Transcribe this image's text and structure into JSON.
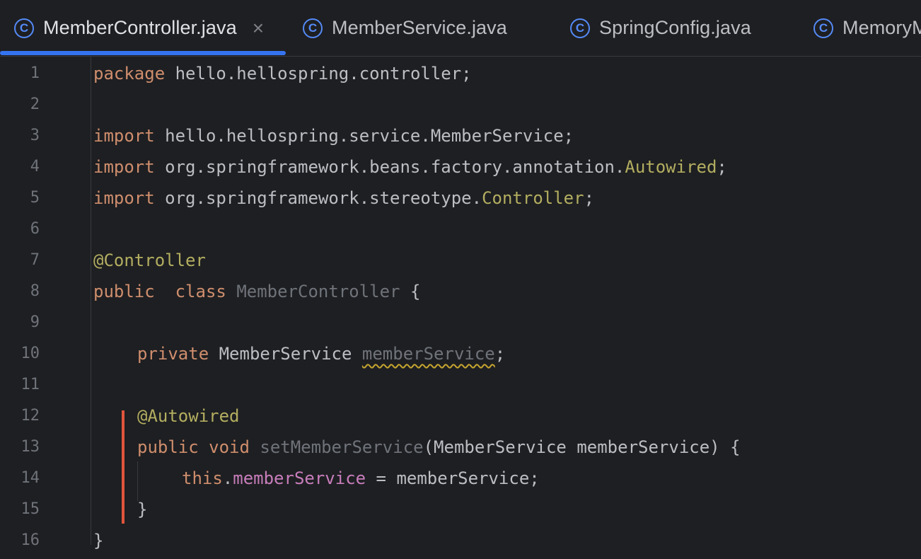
{
  "tabs": [
    {
      "icon": "class-icon",
      "glyph": "C",
      "label": "MemberController.java",
      "active": true,
      "close": "×"
    },
    {
      "icon": "class-icon",
      "glyph": "C",
      "label": "MemberService.java",
      "active": false
    },
    {
      "icon": "class-icon",
      "glyph": "C",
      "label": "SpringConfig.java",
      "active": false
    },
    {
      "icon": "class-icon",
      "glyph": "C",
      "label": "MemoryMemberRepository.java",
      "active": false
    }
  ],
  "editor": {
    "line_numbers": [
      "1",
      "2",
      "3",
      "4",
      "5",
      "6",
      "7",
      "8",
      "9",
      "10",
      "11",
      "12",
      "13",
      "14",
      "15",
      "16"
    ],
    "lines": {
      "l1": {
        "kw": "package",
        "rest": " hello.hellospring.controller;"
      },
      "l3": {
        "kw": "import",
        "rest": " hello.hellospring.service.MemberService;"
      },
      "l4": {
        "kw": "import",
        "rest": " org.springframework.beans.factory.annotation.",
        "cls": "Autowired",
        "end": ";"
      },
      "l5": {
        "kw": "import",
        "rest": " org.springframework.stereotype.",
        "cls": "Controller",
        "end": ";"
      },
      "l7": {
        "ann": "@Controller"
      },
      "l8": {
        "kw1": "public",
        "kw2": "class",
        "name": "MemberController",
        "end": " {"
      },
      "l10": {
        "kw": "private",
        "type": " MemberService ",
        "field": "memberService",
        "end": ";"
      },
      "l12": {
        "ann": "@Autowired"
      },
      "l13": {
        "kw1": "public",
        "kw2": "void",
        "method": "setMemberService",
        "params": "(MemberService memberService) {"
      },
      "l14": {
        "kw": "this",
        "dot": ".",
        "field": "memberService",
        "rest": " = memberService;"
      },
      "l15": {
        "text": "}"
      },
      "l16": {
        "text": "}"
      }
    }
  },
  "colors": {
    "background": "#1e1f22",
    "keyword": "#cf8e6d",
    "annotation": "#b3ae60",
    "field": "#c77dbb",
    "accent": "#3574f0",
    "change_marker": "#e0553c"
  }
}
